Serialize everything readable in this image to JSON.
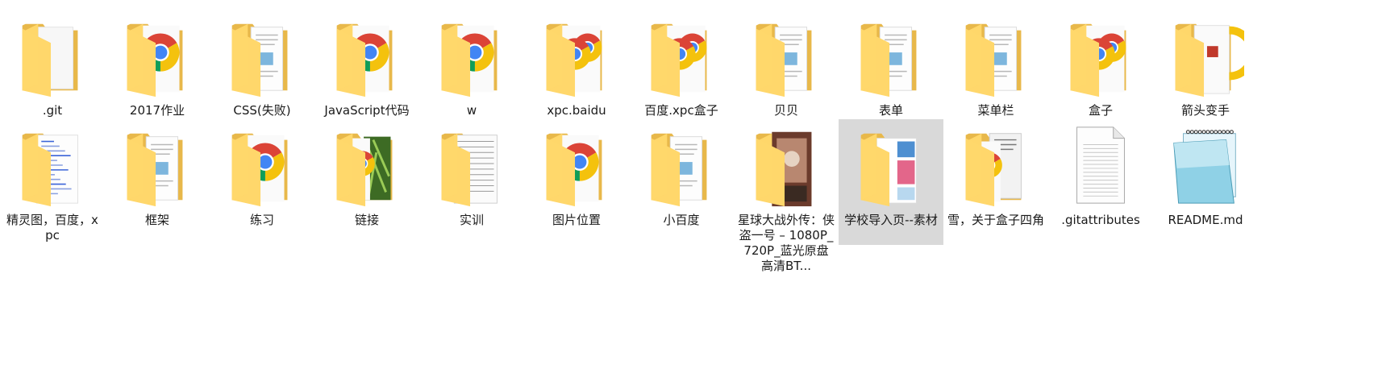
{
  "folder_view": {
    "items": [
      {
        "label": ".git",
        "type": "folder",
        "overlay": "none"
      },
      {
        "label": "2017作业",
        "type": "folder",
        "overlay": "chrome"
      },
      {
        "label": "CSS(失败)",
        "type": "folder",
        "overlay": "document"
      },
      {
        "label": "JavaScript代码",
        "type": "folder",
        "overlay": "chrome"
      },
      {
        "label": "w",
        "type": "folder",
        "overlay": "chrome"
      },
      {
        "label": "xpc.baidu",
        "type": "folder",
        "overlay": "chrome-double"
      },
      {
        "label": "百度.xpc盒子",
        "type": "folder",
        "overlay": "chrome-double"
      },
      {
        "label": "贝贝",
        "type": "folder",
        "overlay": "document"
      },
      {
        "label": "表单",
        "type": "folder",
        "overlay": "document"
      },
      {
        "label": "菜单栏",
        "type": "folder",
        "overlay": "document"
      },
      {
        "label": "盒子",
        "type": "folder",
        "overlay": "chrome-double"
      },
      {
        "label": "箭头变手",
        "type": "folder",
        "overlay": "chrome-red"
      },
      {
        "label": "精灵图，百度，xpc",
        "type": "folder",
        "overlay": "code"
      },
      {
        "label": "框架",
        "type": "folder",
        "overlay": "document"
      },
      {
        "label": "练习",
        "type": "folder",
        "overlay": "chrome"
      },
      {
        "label": "链接",
        "type": "folder",
        "overlay": "chrome-photo"
      },
      {
        "label": "实训",
        "type": "folder",
        "overlay": "spreadsheet"
      },
      {
        "label": "图片位置",
        "type": "folder",
        "overlay": "chrome"
      },
      {
        "label": "小百度",
        "type": "folder",
        "overlay": "document"
      },
      {
        "label": "星球大战外传：侠盗一号 – 1080P_720P_蓝光原盘高清BT...",
        "type": "folder",
        "overlay": "movie"
      },
      {
        "label": "学校导入页--素材",
        "type": "folder",
        "overlay": "images",
        "selected": true
      },
      {
        "label": "雪，关于盒子四角",
        "type": "folder",
        "overlay": "chrome-doc"
      },
      {
        "label": ".gitattributes",
        "type": "file",
        "overlay": "text-file"
      },
      {
        "label": "README.md",
        "type": "file",
        "overlay": "notepad"
      }
    ]
  },
  "colors": {
    "folder_back": "#e8b84a",
    "folder_front": "#ffd76b",
    "selection": "#d9d9d9",
    "chrome_red": "#db4437",
    "chrome_yellow": "#f4c20d",
    "chrome_green": "#0f9d58",
    "chrome_blue": "#4285f4"
  }
}
